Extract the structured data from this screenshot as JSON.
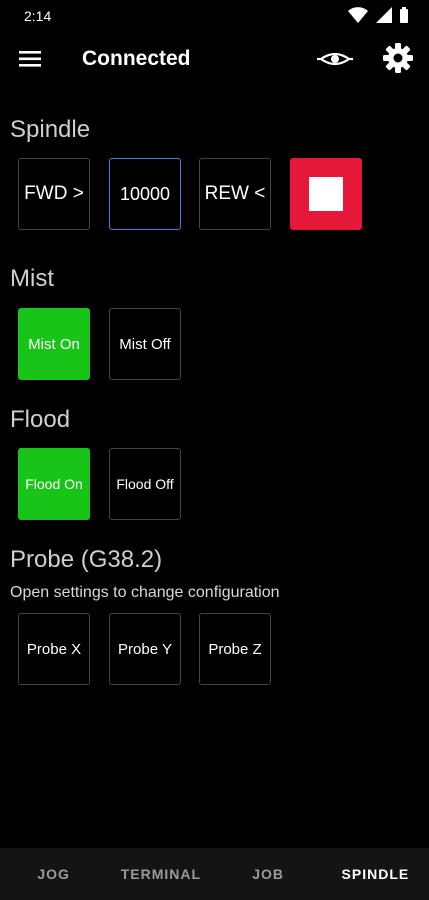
{
  "status": {
    "time": "2:14"
  },
  "header": {
    "title": "Connected"
  },
  "spindle": {
    "label": "Spindle",
    "fwd_label": "FWD >",
    "speed_value": "10000",
    "rew_label": "REW <"
  },
  "mist": {
    "label": "Mist",
    "on_label": "Mist On",
    "off_label": "Mist Off"
  },
  "flood": {
    "label": "Flood",
    "on_label": "Flood On",
    "off_label": "Flood Off"
  },
  "probe": {
    "label": "Probe (G38.2)",
    "subtitle": "Open settings to change configuration",
    "x_label": "Probe X",
    "y_label": "Probe Y",
    "z_label": "Probe Z"
  },
  "tabs": [
    {
      "label": "JOG"
    },
    {
      "label": "TERMINAL"
    },
    {
      "label": "JOB"
    },
    {
      "label": "SPINDLE"
    }
  ],
  "active_tab": "SPINDLE",
  "colors": {
    "on_green": "#19c419",
    "stop_red": "#e5183a",
    "input_border_blue": "#3b7fd6"
  }
}
